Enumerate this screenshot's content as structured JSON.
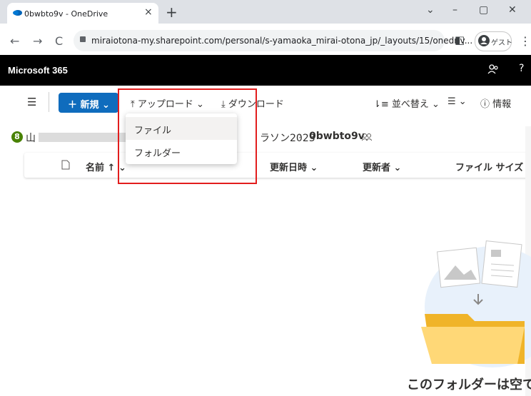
{
  "browser": {
    "tab_title": "0bwbto9v - OneDrive",
    "tab_close": "×",
    "new_tab": "+",
    "url": "miraiotona-my.sharepoint.com/personal/s-yamaoka_mirai-otona_jp/_layouts/15/onedriv...",
    "guest_label": "ゲスト",
    "window_min": "–",
    "window_max": "▢",
    "window_close": "✕",
    "dropdown_chev": "⌄",
    "back": "←",
    "forward": "→",
    "reload": "C",
    "menu": "⋮",
    "sidepanel": "◧"
  },
  "m365": {
    "title": "Microsoft 365",
    "share_icon": "ℰ",
    "help": "?"
  },
  "commandbar": {
    "new_label": "＋ 新規 ⌄",
    "upload_label": "⤒ アップロード ⌄",
    "download_label": "⤓ ダウンロード",
    "sort_label": "⇂≡ 並べ替え ⌄",
    "view_label": "☰ ⌄",
    "info_label": "ⓘ 情報",
    "hamburger": "☰"
  },
  "breadcrumb": {
    "user_initial": "8",
    "prefix": "山",
    "mid": "ラソン2023",
    "separator": "›",
    "current": "0bwbto9v"
  },
  "columns": {
    "name": "名前 ↑ ⌄",
    "modified": "更新日時 ⌄",
    "modified_by": "更新者 ⌄",
    "size": "ファイル サイズ ⌄"
  },
  "upload_menu": {
    "items": [
      {
        "label": "ファイル"
      },
      {
        "label": "フォルダー"
      }
    ]
  },
  "empty_state": {
    "text": "このフォルダーは空て"
  },
  "colors": {
    "accent": "#0f6cbd",
    "highlight_box": "#e21d1d",
    "header_bg": "#000000"
  }
}
